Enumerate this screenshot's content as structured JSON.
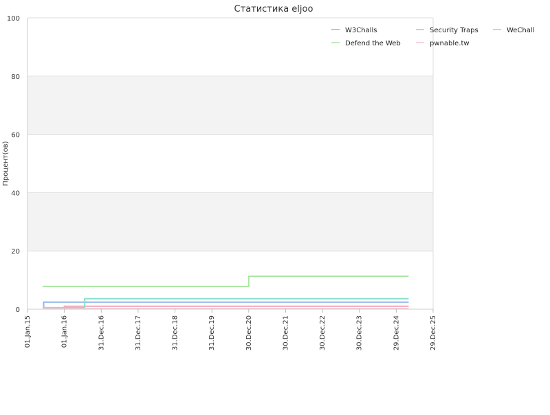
{
  "chart_data": {
    "type": "line",
    "title": "Статистика eljoo",
    "xlabel": "",
    "ylabel": "Процент(ов)",
    "ylim": [
      0,
      100
    ],
    "xlim": [
      "2015-01-01",
      "2025-12-29"
    ],
    "y_ticks": [
      0,
      20,
      40,
      60,
      80,
      100
    ],
    "x_ticks": [
      {
        "date": "2015-01-01",
        "label": "01.Jan.15"
      },
      {
        "date": "2016-01-01",
        "label": "01.Jan.16"
      },
      {
        "date": "2016-12-31",
        "label": "31.Dec.16"
      },
      {
        "date": "2017-12-31",
        "label": "31.Dec.17"
      },
      {
        "date": "2018-12-31",
        "label": "31.Dec.18"
      },
      {
        "date": "2019-12-31",
        "label": "31.Dec.19"
      },
      {
        "date": "2020-12-30",
        "label": "30.Dec.20"
      },
      {
        "date": "2021-12-30",
        "label": "30.Dec.21"
      },
      {
        "date": "2022-12-30",
        "label": "30.Dec.22"
      },
      {
        "date": "2023-12-30",
        "label": "30.Dec.23"
      },
      {
        "date": "2024-12-29",
        "label": "29.Dec.24"
      },
      {
        "date": "2025-12-29",
        "label": "29.Dec.25"
      }
    ],
    "grid": true,
    "legend": "top-right",
    "step": true,
    "series": [
      {
        "name": "W3Challs",
        "color": "#8fb4ec",
        "points": [
          [
            "2015-06-01",
            0.3
          ],
          [
            "2015-06-10",
            2.4
          ],
          [
            "2025-05-01",
            2.4
          ]
        ]
      },
      {
        "name": "Security Traps",
        "color": "#f3a6b6",
        "points": [
          [
            "2015-06-01",
            0.5
          ],
          [
            "2016-01-01",
            1.0
          ],
          [
            "2025-05-01",
            1.0
          ]
        ]
      },
      {
        "name": "WeChall",
        "color": "#88e0cf",
        "points": [
          [
            "2015-06-01",
            0.5
          ],
          [
            "2016-07-20",
            3.6
          ],
          [
            "2025-05-01",
            3.6
          ]
        ]
      },
      {
        "name": "Defend the Web",
        "color": "#a8e6a0",
        "points": [
          [
            "2015-06-01",
            7.8
          ],
          [
            "2020-12-30",
            11.3
          ],
          [
            "2025-05-01",
            11.3
          ]
        ]
      },
      {
        "name": "pwnable.tw",
        "color": "#f0c8d6",
        "points": [
          [
            "2015-06-01",
            0.2
          ],
          [
            "2025-05-01",
            0.2
          ]
        ]
      }
    ]
  }
}
